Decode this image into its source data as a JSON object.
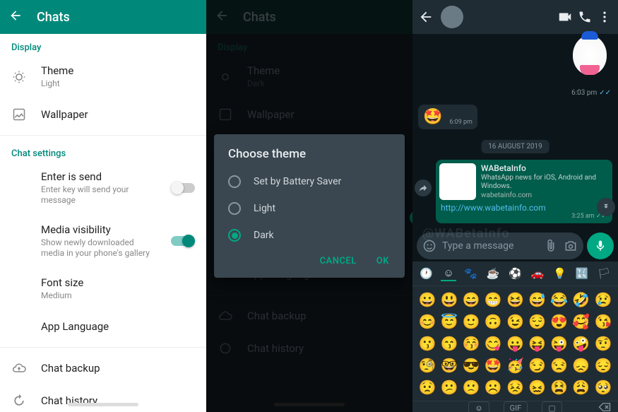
{
  "panel1": {
    "title": "Chats",
    "section_display": "Display",
    "theme_label": "Theme",
    "theme_value": "Light",
    "wallpaper_label": "Wallpaper",
    "section_chat": "Chat settings",
    "enter_label": "Enter is send",
    "enter_sub": "Enter key will send your message",
    "media_label": "Media visibility",
    "media_sub": "Show newly downloaded media in your phone's gallery",
    "font_label": "Font size",
    "font_value": "Medium",
    "applang_label": "App Language",
    "backup_label": "Chat backup",
    "history_label": "Chat history"
  },
  "panel2": {
    "title": "Chats",
    "section_display": "Display",
    "theme_label": "Theme",
    "theme_value": "Dark",
    "wallpaper_label": "Wallpaper",
    "applang_label": "App Language",
    "backup_label": "Chat backup",
    "history_label": "Chat history",
    "dialog_title": "Choose theme",
    "opt1": "Set by Battery Saver",
    "opt2": "Light",
    "opt3": "Dark",
    "cancel": "CANCEL",
    "ok": "OK"
  },
  "panel3": {
    "sticker_time": "6:03 pm",
    "in_time": "6:09 pm",
    "date_pill": "16 AUGUST 2019",
    "card_title": "WABetaInfo",
    "card_desc": "WhatsApp news for iOS, Android and Windows.",
    "card_site": "wabetainfo.com",
    "link": "http://www.wabetainfo.com",
    "out_time": "3:25 am",
    "watermark": "@WABetaInfo",
    "placeholder": "Type a message",
    "apple_glyph": "",
    "bottom_gif": "GIF",
    "emojis": [
      "😀",
      "😃",
      "😄",
      "😁",
      "😆",
      "😅",
      "😂",
      "🤣",
      "😢",
      "😊",
      "😇",
      "🙂",
      "🙃",
      "😉",
      "😌",
      "😍",
      "🥰",
      "😘",
      "😗",
      "😙",
      "😚",
      "😋",
      "😛",
      "😝",
      "😜",
      "🤪",
      "🤨",
      "🧐",
      "🤓",
      "😎",
      "🤩",
      "🥳",
      "😏",
      "😒",
      "😞",
      "😔",
      "😟",
      "😕",
      "🙁",
      "☹️",
      "😣",
      "😖",
      "😫",
      "😩",
      "🥺"
    ]
  }
}
